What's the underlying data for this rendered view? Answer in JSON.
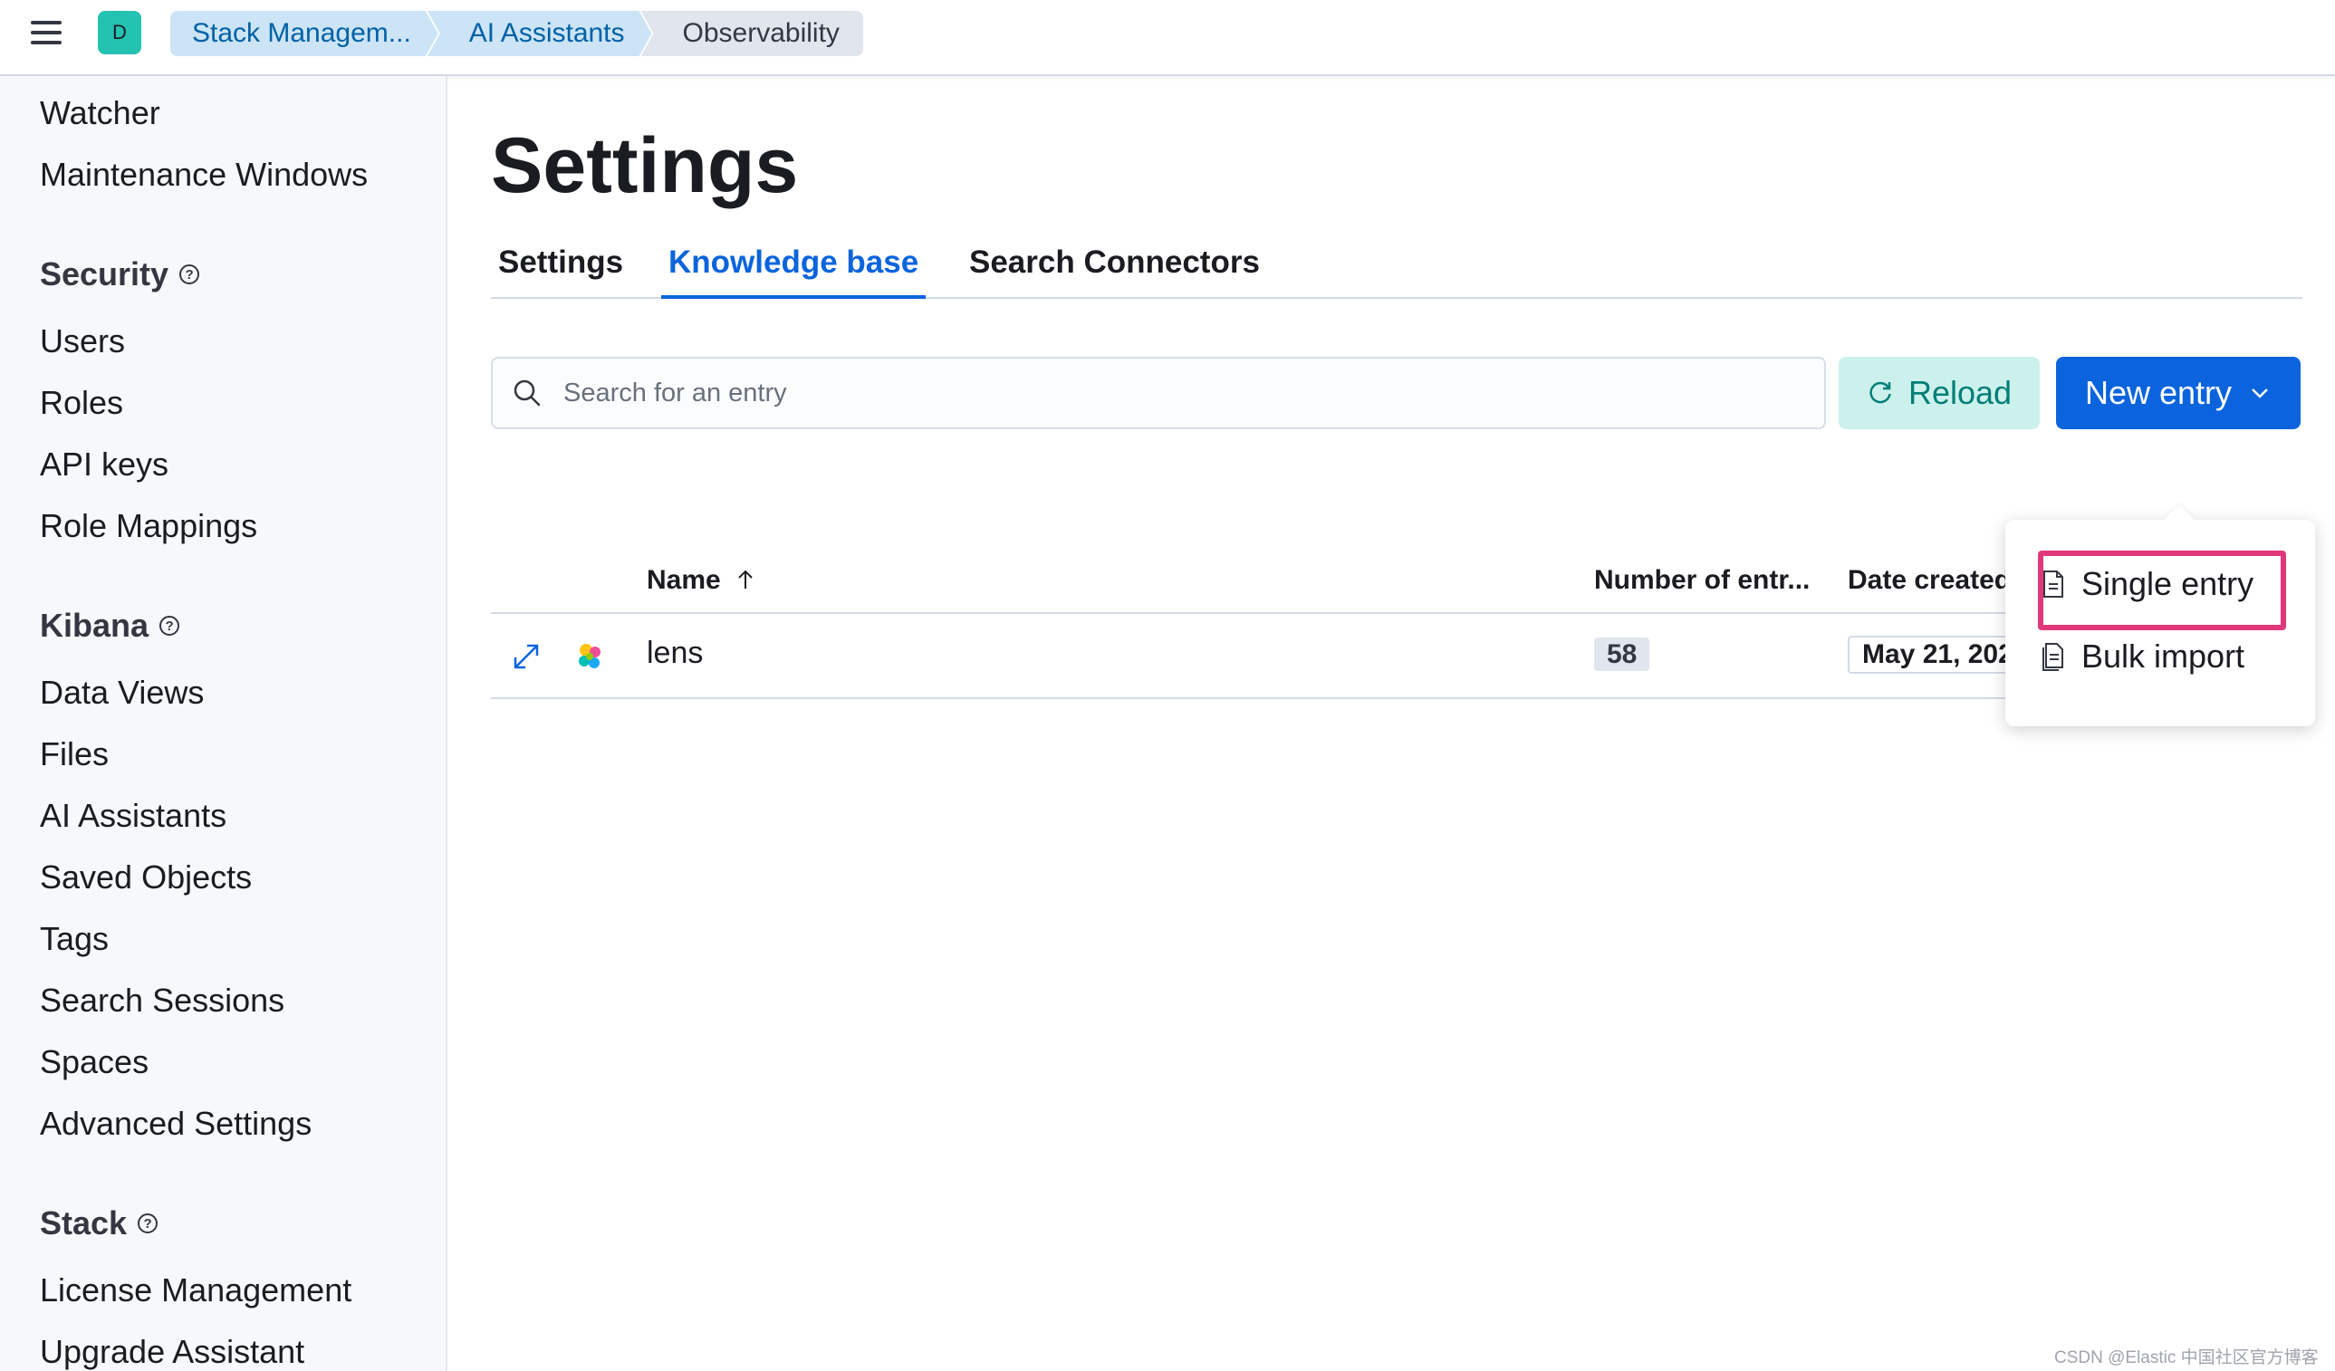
{
  "header": {
    "avatar_letter": "D",
    "breadcrumbs": [
      "Stack Managem...",
      "AI Assistants",
      "Observability"
    ]
  },
  "sidebar": {
    "items_top": [
      "Watcher",
      "Maintenance Windows"
    ],
    "security": {
      "heading": "Security",
      "items": [
        "Users",
        "Roles",
        "API keys",
        "Role Mappings"
      ]
    },
    "kibana": {
      "heading": "Kibana",
      "items": [
        "Data Views",
        "Files",
        "AI Assistants",
        "Saved Objects",
        "Tags",
        "Search Sessions",
        "Spaces",
        "Advanced Settings"
      ]
    },
    "stack": {
      "heading": "Stack",
      "items": [
        "License Management",
        "Upgrade Assistant"
      ]
    },
    "help_glyph": "?"
  },
  "main": {
    "title": "Settings",
    "tabs": [
      "Settings",
      "Knowledge base",
      "Search Connectors"
    ],
    "active_tab": "Knowledge base",
    "search": {
      "placeholder": "Search for an entry",
      "value": ""
    },
    "reload_label": "Reload",
    "new_entry_label": "New entry",
    "table": {
      "columns": [
        "Name",
        "Number of entr...",
        "Date created"
      ],
      "sort_column": "Name",
      "rows": [
        {
          "name": "lens",
          "entries": "58",
          "date": "May 21, 202..."
        }
      ]
    },
    "dropdown": {
      "items": [
        "Single entry",
        "Bulk import"
      ],
      "highlighted": "Single entry"
    }
  },
  "colors": {
    "primary": "#0b64dd",
    "success_bg": "#ccf1ec",
    "success_text": "#007e77",
    "highlight": "#e0397b",
    "avatar": "#24c2b0"
  },
  "watermark": "CSDN @Elastic 中国社区官方博客"
}
